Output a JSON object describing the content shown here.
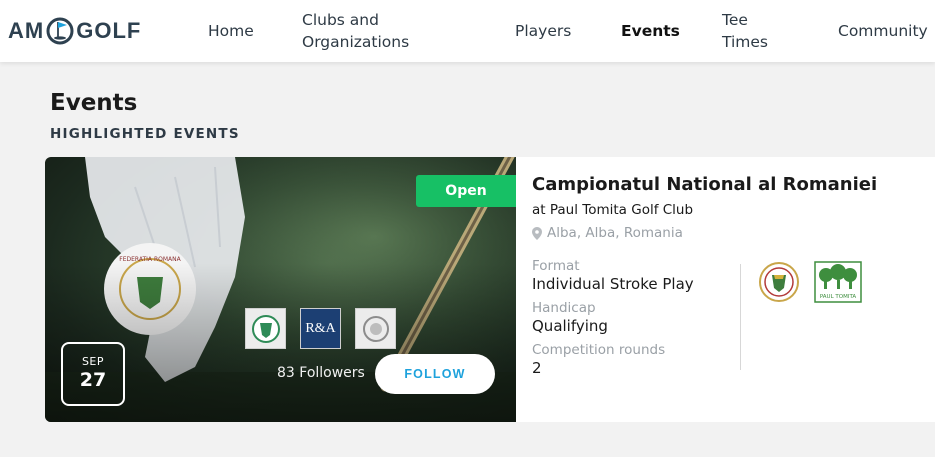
{
  "brand": {
    "logo_left": "AM",
    "logo_right": "GOLF"
  },
  "nav": {
    "home": "Home",
    "clubs_line1": "Clubs and",
    "clubs_line2": "Organizations",
    "players": "Players",
    "events": "Events",
    "tee_line1": "Tee",
    "tee_line2": "Times",
    "community": "Community"
  },
  "page": {
    "title": "Events",
    "section": "HIGHLIGHTED EVENTS"
  },
  "event": {
    "status": "Open",
    "date_month": "SEP",
    "date_day": "27",
    "followers": "83 Followers",
    "follow_label": "FOLLOW",
    "title": "Campionatul National al Romaniei",
    "venue": "at Paul Tomita Golf Club",
    "location": "Alba, Alba, Romania",
    "format_label": "Format",
    "format_value": "Individual Stroke Play",
    "handicap_label": "Handicap",
    "handicap_value": "Qualifying",
    "rounds_label": "Competition rounds",
    "rounds_value": "2",
    "sponsor_2_text": "R&A",
    "club_logo_2_text": "PAUL TOMITA"
  },
  "colors": {
    "status_green": "#17c065",
    "follow_blue": "#1ea2dc",
    "brand_navy": "#2e4150"
  }
}
